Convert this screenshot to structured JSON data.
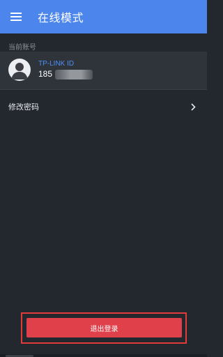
{
  "appbar": {
    "title": "在线模式",
    "menu_icon": "hamburger-menu-icon"
  },
  "account": {
    "section_label": "当前账号",
    "type_label": "TP-LINK ID",
    "number_visible": "185",
    "avatar_icon": "user-avatar-icon"
  },
  "menu": {
    "change_password_label": "修改密码",
    "chevron_icon": "chevron-right-icon"
  },
  "actions": {
    "logout_label": "退出登录"
  },
  "colors": {
    "appbar": "#4c85ec",
    "background": "#23272e",
    "account_row": "#2f343b",
    "link_blue": "#4d8ff5",
    "logout_button": "#e0404a",
    "highlight_border": "#e23b3b"
  }
}
